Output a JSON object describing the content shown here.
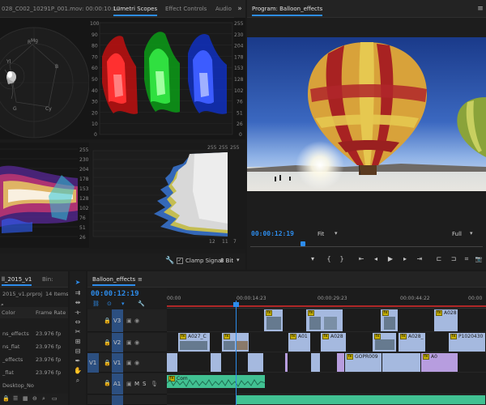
{
  "scopes": {
    "tabs": [
      "028_C002_10291P_001.mov: 00:00:10:17",
      "Lumetri Scopes",
      "Effect Controls",
      "Audio"
    ],
    "more": "»",
    "parade_scale": [
      "100",
      "90",
      "80",
      "70",
      "60",
      "50",
      "40",
      "30",
      "20",
      "10",
      "0"
    ],
    "parade_scale_right": [
      "255",
      "230",
      "204",
      "178",
      "153",
      "128",
      "102",
      "76",
      "51",
      "26",
      "0"
    ],
    "hist_scale": [
      "255",
      "230",
      "204",
      "178",
      "153",
      "128",
      "102",
      "76",
      "51",
      "26"
    ],
    "hist_top_values": [
      "255",
      "255",
      "255"
    ],
    "hist_bottom_values": [
      "12",
      "11",
      "7"
    ],
    "clamp_label": "Clamp Signal",
    "bit_depth": "8 Bit",
    "vector_labels": [
      "R",
      "Mg",
      "B",
      "Cy",
      "G",
      "Yl"
    ],
    "colors": {
      "red": "#ff4040",
      "green": "#48d048",
      "blue": "#4c6cff",
      "accent": "#2d8ceb"
    }
  },
  "program": {
    "title": "Program: Balloon_effects",
    "more": "≡",
    "timecode": "00:00:12:19",
    "fit": "Fit",
    "quality": "Full",
    "controls": [
      "▾",
      "{",
      "}",
      "⇤",
      "◂",
      "▶",
      "▸",
      "⇥",
      "⊏",
      "⊐",
      "⌗",
      "📷"
    ]
  },
  "project": {
    "tabs": [
      "ll_2015_v1",
      "Bin:"
    ],
    "file": "2015_v1.prproj",
    "count": "14 Items",
    "col_name": "Color",
    "col_fr": "Frame Rate",
    "items": [
      {
        "name": "ns_effects",
        "fr": "23.976 fp"
      },
      {
        "name": "ns_flat",
        "fr": "23.976 fp"
      },
      {
        "name": "_effects",
        "fr": "23.976 fp"
      },
      {
        "name": "_flat",
        "fr": "23.976 fp"
      },
      {
        "name": "Desktop_No",
        "fr": ""
      }
    ]
  },
  "timeline": {
    "tab": "Balloon_effects",
    "more": "≡",
    "timecode": "00:00:12:19",
    "ruler": [
      "00:00",
      "00:00:14:23",
      "00:00:29:23",
      "00:00:44:22",
      "00:00"
    ],
    "tracks": {
      "v3": "V3",
      "v2": "V2",
      "v1": "V1",
      "v1_src": "V1",
      "a1": "A1",
      "m": "M",
      "s": "S"
    },
    "clips": {
      "a027": "A027_C",
      "a01": "A01",
      "a028": "A028",
      "a028b": "A028_",
      "p102": "P1020430",
      "gopr": "GOPR009",
      "a0": "A0",
      "com": "Com",
      "fx": "fx"
    }
  }
}
